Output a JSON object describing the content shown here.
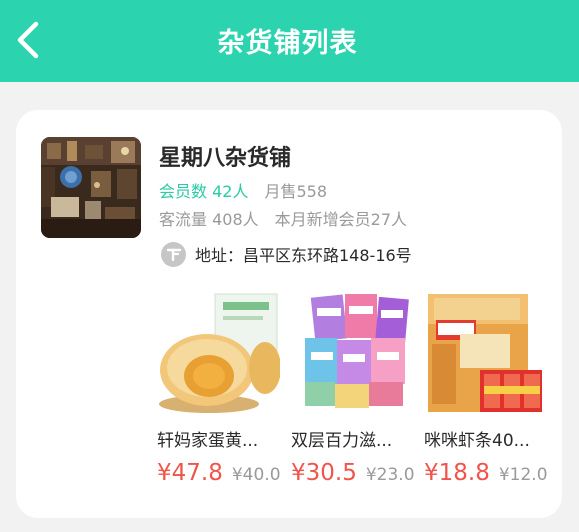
{
  "header": {
    "title": "杂货铺列表",
    "back_icon": "chevron-left-icon",
    "bg_color": "#2bd3ae"
  },
  "store": {
    "name": "星期八杂货铺",
    "members": "会员数 42人",
    "monthly_sales": "月售558",
    "traffic": "客流量 408人",
    "new_members": "本月新增会员27人",
    "address": "地址：昌平区东环路148-16号",
    "address_icon": "location-logo-icon"
  },
  "products": [
    {
      "name": "轩妈家蛋黄...",
      "price": "¥47.8",
      "original_price": "¥40.0"
    },
    {
      "name": "双层百力滋...",
      "price": "¥30.5",
      "original_price": "¥23.0"
    },
    {
      "name": "咪咪虾条40...",
      "price": "¥18.8",
      "original_price": "¥12.0"
    }
  ],
  "colors": {
    "accent": "#2bd3ae",
    "price": "#f0554b",
    "muted": "#9a9a9a"
  }
}
